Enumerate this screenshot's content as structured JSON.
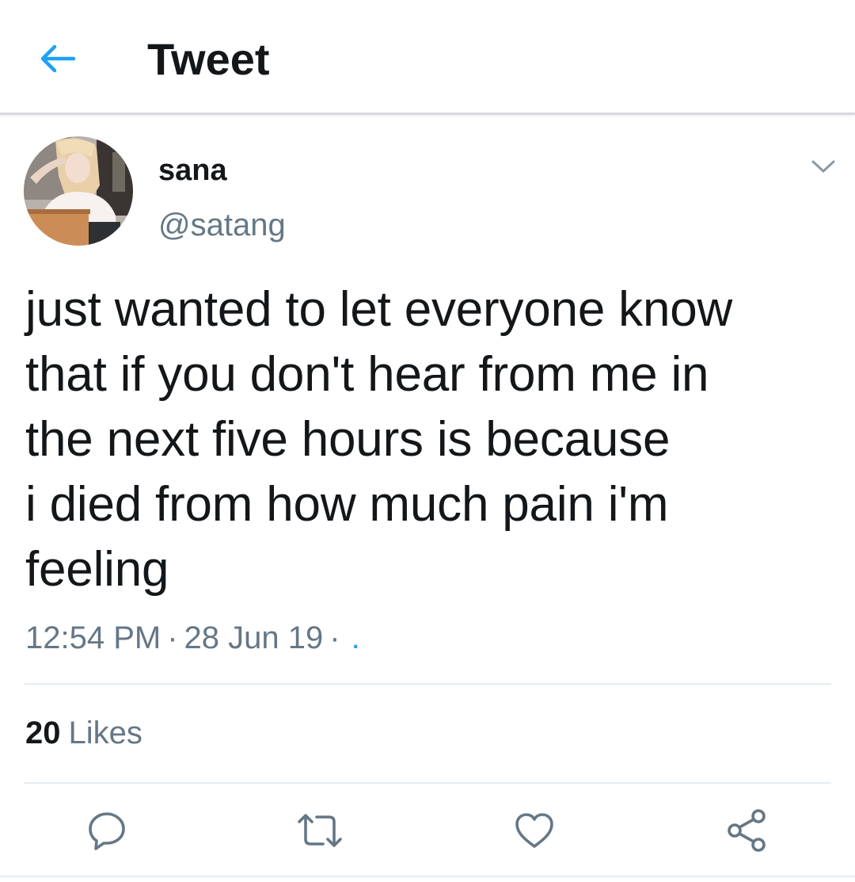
{
  "header": {
    "title": "Tweet",
    "back_icon": "back-arrow-icon"
  },
  "tweet": {
    "display_name": "sana",
    "handle": "@satang",
    "text": "just wanted to let everyone know\nthat if you don't hear from me in\nthe next five hours is because\ni died from how much pain i'm\nfeeling",
    "time": "12:54 PM",
    "date": "28 Jun 19",
    "separator": "·",
    "source": ".",
    "likes_count": "20",
    "likes_label": "Likes"
  },
  "actions": [
    {
      "name": "reply",
      "icon": "reply-icon"
    },
    {
      "name": "retweet",
      "icon": "retweet-icon"
    },
    {
      "name": "like",
      "icon": "heart-icon"
    },
    {
      "name": "share",
      "icon": "share-icon"
    }
  ],
  "colors": {
    "accent": "#1da1f2",
    "text": "#14171a",
    "secondary": "#657786",
    "divider": "#e6ecf0"
  }
}
